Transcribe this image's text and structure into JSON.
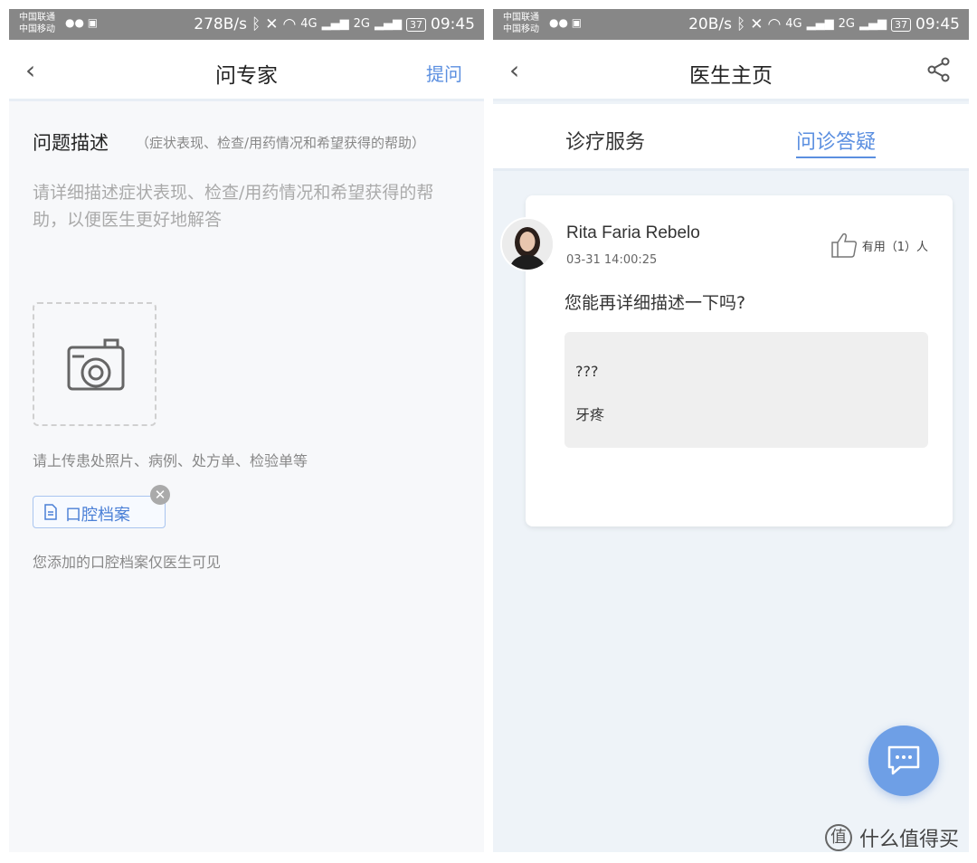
{
  "left": {
    "status": {
      "carrier1": "中国联通",
      "carrier2": "中国移动",
      "speed": "278B/s",
      "net1": "4G",
      "net2": "2G",
      "battery": "37",
      "time": "09:45"
    },
    "nav": {
      "back": "‹",
      "title": "问专家",
      "action": "提问"
    },
    "question": {
      "title": "问题描述",
      "hint": "（症状表现、检查/用药情况和希望获得的帮助）",
      "placeholder": "请详细描述症状表现、检查/用药情况和希望获得的帮助，以便医生更好地解答"
    },
    "upload_hint": "请上传患处照片、病例、处方单、检验单等",
    "record_label": "口腔档案",
    "record_note": "您添加的口腔档案仅医生可见"
  },
  "right": {
    "status": {
      "carrier1": "中国联通",
      "carrier2": "中国移动",
      "speed": "20B/s",
      "net1": "4G",
      "net2": "2G",
      "battery": "37",
      "time": "09:45"
    },
    "nav": {
      "back": "‹",
      "title": "医生主页"
    },
    "tabs": [
      "诊疗服务",
      "问诊答疑"
    ],
    "card": {
      "name": "Rita Faria Rebelo",
      "time": "03-31 14:00:25",
      "helpful": "有用（1）人",
      "question": "您能再详细描述一下吗?",
      "answers": [
        "???",
        "牙疼"
      ]
    }
  },
  "watermark": "什么值得买",
  "colors": {
    "accent": "#5b8fe0",
    "fab": "#6e9fe6",
    "statusbar": "#878787"
  },
  "icons": [
    "back-icon",
    "camera-icon",
    "document-icon",
    "close-icon",
    "share-icon",
    "thumbs-up-icon",
    "chat-icon",
    "wifi-icon",
    "bluetooth-icon",
    "mute-icon"
  ]
}
